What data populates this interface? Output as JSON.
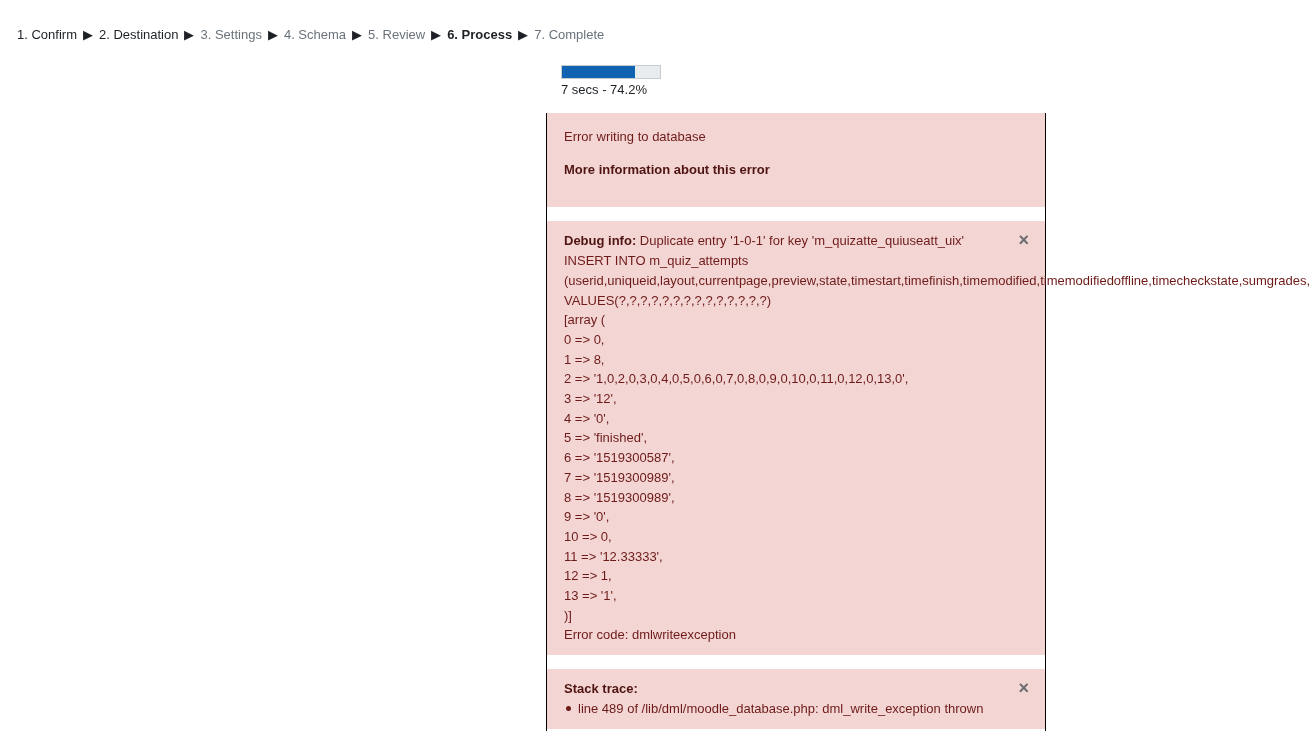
{
  "steps": [
    {
      "label": "1. Confirm",
      "reached": true,
      "selected": false
    },
    {
      "arrow": "▶",
      "label": "2. Destination",
      "reached": true,
      "selected": false
    },
    {
      "arrow": "▶",
      "label": "3. Settings",
      "reached": false,
      "selected": false
    },
    {
      "arrow": "▶",
      "label": "4. Schema",
      "reached": false,
      "selected": false
    },
    {
      "arrow": "▶",
      "label": "5. Review",
      "reached": false,
      "selected": false
    },
    {
      "arrow": "▶",
      "label": "6. Process",
      "reached": true,
      "selected": true
    },
    {
      "arrow": "▶",
      "label": "7. Complete",
      "reached": false,
      "selected": false
    }
  ],
  "progress": {
    "level": 0.742,
    "caption": "7 secs - 74.2%"
  },
  "error": {
    "message": "Error writing to database",
    "more_info": "More information about this error"
  },
  "debug": {
    "heading": "Debug info:",
    "summary": "Duplicate entry '1-0-1' for key 'm_quizatte_quiuseatt_uix'",
    "close": "×",
    "lines": [
      "INSERT INTO m_quiz_attempts",
      "(userid,uniqueid,layout,currentpage,preview,state,timestart,timefinish,timemodified,timemodifiedoffline,timecheckstate,sumgrades,",
      "VALUES(?,?,?,?,?,?,?,?,?,?,?,?,?,?)",
      "[array (",
      "0 => 0,",
      "1 => 8,",
      "2 => '1,0,2,0,3,0,4,0,5,0,6,0,7,0,8,0,9,0,10,0,11,0,12,0,13,0',",
      "3 => '12',",
      "4 => '0',",
      "5 => 'finished',",
      "6 => '1519300587',",
      "7 => '1519300989',",
      "8 => '1519300989',",
      "9 => '0',",
      "10 => 0,",
      "11 => '12.33333',",
      "12 => 1,",
      "13 => '1',",
      ")]",
      "Error code: dmlwriteexception"
    ]
  },
  "stack": {
    "heading": "Stack trace:",
    "close": "×",
    "items": [
      "line 489 of /lib/dml/moodle_database.php: dml_write_exception thrown"
    ]
  }
}
